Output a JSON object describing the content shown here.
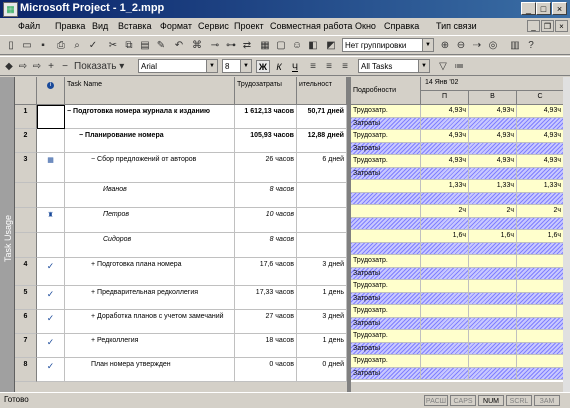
{
  "window": {
    "title": "Microsoft Project - 1_2.mpp"
  },
  "menu": [
    "Файл",
    "Правка",
    "Вид",
    "Вставка",
    "Формат",
    "Сервис",
    "Проект",
    "Совместная работа",
    "Окно",
    "Справка",
    "Тип связи"
  ],
  "toolbar": {
    "grouping": "Нет группировки",
    "show_label": "Показать",
    "font": "Arial",
    "size": "8",
    "filter": "All Tasks",
    "bold": "Ж",
    "italic": "К",
    "underline": "Ч"
  },
  "sidebar_label": "Task Usage",
  "table": {
    "headers": {
      "task": "Task Name",
      "work": "Трудозатраты",
      "duration": "ительност"
    },
    "rows": [
      {
        "id": "1",
        "name": "− Подготовка номера журнала к изданию",
        "work": "1 612,13 часов",
        "duration": "50,71 дней",
        "indent": 0,
        "style": "bold"
      },
      {
        "id": "2",
        "name": "− Планирование номера",
        "work": "105,93 часов",
        "duration": "12,88 дней",
        "indent": 1,
        "style": "bold"
      },
      {
        "id": "3",
        "name": "− Сбор предложений от авторов",
        "work": "26 часов",
        "duration": "6 дней",
        "indent": 2,
        "style": "normal"
      },
      {
        "id": "",
        "name": "Иванов",
        "work": "8 часов",
        "duration": "",
        "indent": 3,
        "style": "italic"
      },
      {
        "id": "",
        "name": "Петров",
        "work": "10 часов",
        "duration": "",
        "indent": 3,
        "style": "italic"
      },
      {
        "id": "",
        "name": "Сидоров",
        "work": "8 часов",
        "duration": "",
        "indent": 3,
        "style": "italic"
      },
      {
        "id": "4",
        "name": "+ Подготовка плана номера",
        "work": "17,6 часов",
        "duration": "3 дней",
        "indent": 2,
        "style": "normal"
      },
      {
        "id": "5",
        "name": "+ Предварительная редколлегия",
        "work": "17,33 часов",
        "duration": "1 день",
        "indent": 2,
        "style": "normal"
      },
      {
        "id": "6",
        "name": "+ Доработка планов с учетом замечаний",
        "work": "27 часов",
        "duration": "3 дней",
        "indent": 2,
        "style": "normal"
      },
      {
        "id": "7",
        "name": "+ Редколлегия",
        "work": "18 часов",
        "duration": "1 день",
        "indent": 2,
        "style": "normal"
      },
      {
        "id": "8",
        "name": "План номера утвержден",
        "work": "0 часов",
        "duration": "0 дней",
        "indent": 2,
        "style": "normal"
      }
    ]
  },
  "timescale": {
    "details_header": "Подробности",
    "week": "14 Янв '02",
    "days": [
      "П",
      "В",
      "С"
    ],
    "rows": [
      {
        "band": "yellow",
        "label": "Трудозатр.",
        "values": [
          "4,93ч",
          "4,93ч",
          "4,93ч"
        ]
      },
      {
        "band": "hatch",
        "label": "Затраты",
        "values": [
          "",
          "",
          ""
        ]
      },
      {
        "band": "yellow",
        "label": "Трудозатр.",
        "values": [
          "4,93ч",
          "4,93ч",
          "4,93ч"
        ]
      },
      {
        "band": "hatch",
        "label": "Затраты",
        "values": [
          "",
          "",
          ""
        ]
      },
      {
        "band": "yellow",
        "label": "Трудозатр.",
        "values": [
          "4,93ч",
          "4,93ч",
          "4,93ч"
        ]
      },
      {
        "band": "hatch",
        "label": "Затраты",
        "values": [
          "",
          "",
          ""
        ]
      },
      {
        "band": "yellow",
        "label": "",
        "values": [
          "1,33ч",
          "1,33ч",
          "1,33ч"
        ]
      },
      {
        "band": "hatch",
        "label": "",
        "values": [
          "",
          "",
          ""
        ]
      },
      {
        "band": "yellow",
        "label": "",
        "values": [
          "2ч",
          "2ч",
          "2ч"
        ]
      },
      {
        "band": "hatch",
        "label": "",
        "values": [
          "",
          "",
          ""
        ]
      },
      {
        "band": "yellow",
        "label": "",
        "values": [
          "1,6ч",
          "1,6ч",
          "1,6ч"
        ]
      },
      {
        "band": "hatch",
        "label": "",
        "values": [
          "",
          "",
          ""
        ]
      },
      {
        "band": "yellow",
        "label": "Трудозатр.",
        "values": [
          "",
          "",
          ""
        ]
      },
      {
        "band": "hatch",
        "label": "Затраты",
        "values": [
          "",
          "",
          ""
        ]
      },
      {
        "band": "yellow",
        "label": "Трудозатр.",
        "values": [
          "",
          "",
          ""
        ]
      },
      {
        "band": "hatch",
        "label": "Затраты",
        "values": [
          "",
          "",
          ""
        ]
      },
      {
        "band": "yellow",
        "label": "Трудозатр.",
        "values": [
          "",
          "",
          ""
        ]
      },
      {
        "band": "hatch",
        "label": "Затраты",
        "values": [
          "",
          "",
          ""
        ]
      },
      {
        "band": "yellow",
        "label": "Трудозатр.",
        "values": [
          "",
          "",
          ""
        ]
      },
      {
        "band": "hatch",
        "label": "Затраты",
        "values": [
          "",
          "",
          ""
        ]
      },
      {
        "band": "yellow",
        "label": "Трудозатр.",
        "values": [
          "",
          "",
          ""
        ]
      },
      {
        "band": "hatch",
        "label": "Затраты",
        "values": [
          "",
          "",
          ""
        ]
      }
    ]
  },
  "status": {
    "text": "Готово",
    "indicators": [
      "РАСШ",
      "CAPS",
      "NUM",
      "SCRL",
      "ЗАМ"
    ]
  }
}
